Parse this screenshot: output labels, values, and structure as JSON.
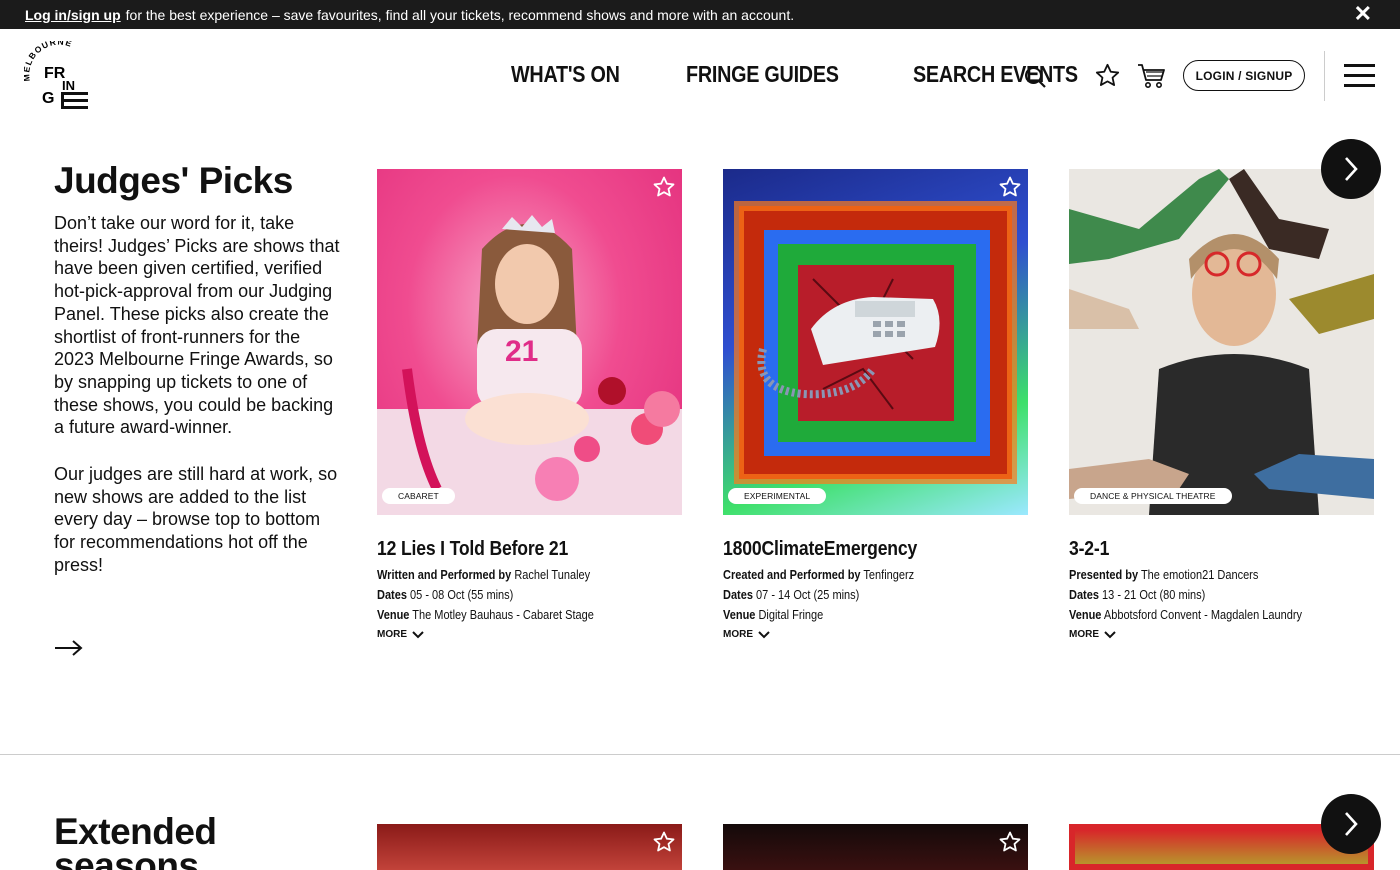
{
  "banner": {
    "link": "Log in/sign up",
    "text": "for the best experience – save favourites, find all your tickets, recommend shows and more with an account.",
    "close": "✕"
  },
  "logo": {
    "top": "MELBOURNE",
    "word1": "FR",
    "word2": "IN",
    "word3": "G",
    "word4": "E"
  },
  "nav": [
    "WHAT'S ON",
    "FRINGE GUIDES",
    "SEARCH EVENTS"
  ],
  "header": {
    "login_label": "LOGIN / SIGNUP"
  },
  "judges": {
    "title": "Judges' Picks",
    "p1": "Don’t take our word for it, take theirs! Judges’ Picks are shows that have been given certified, verified hot-pick-approval from our Judging Panel. These picks also create the shortlist of front-runners for the 2023 Melbourne Fringe Awards, so by snapping up tickets to one of these shows, you could be backing a future award-winner.",
    "p2": "Our judges are still hard at work, so new shows are added to the list every day – browse top to bottom for recommendations hot off the press!",
    "cards": [
      {
        "tag": "CABARET",
        "title": "12 Lies I Told Before 21",
        "credit_label": "Written and Performed by",
        "credit": "Rachel Tunaley",
        "dates_label": "Dates",
        "dates": "05 - 08 Oct (55 mins)",
        "venue_label": "Venue",
        "venue": "The Motley Bauhaus - Cabaret Stage",
        "more": "MORE"
      },
      {
        "tag": "EXPERIMENTAL",
        "title": "1800ClimateEmergency",
        "credit_label": "Created and Performed by",
        "credit": "Tenfingerz",
        "dates_label": "Dates",
        "dates": "07 - 14 Oct (25 mins)",
        "venue_label": "Venue",
        "venue": "Digital Fringe",
        "more": "MORE"
      },
      {
        "tag": "DANCE & PHYSICAL THEATRE",
        "title": "3-2-1",
        "credit_label": "Presented by",
        "credit": "The emotion21 Dancers",
        "dates_label": "Dates",
        "dates": "13 - 21 Oct (80 mins)",
        "venue_label": "Venue",
        "venue": "Abbotsford Convent - Magdalen Laundry",
        "more": "MORE"
      }
    ]
  },
  "extended": {
    "title": "Extended seasons"
  }
}
